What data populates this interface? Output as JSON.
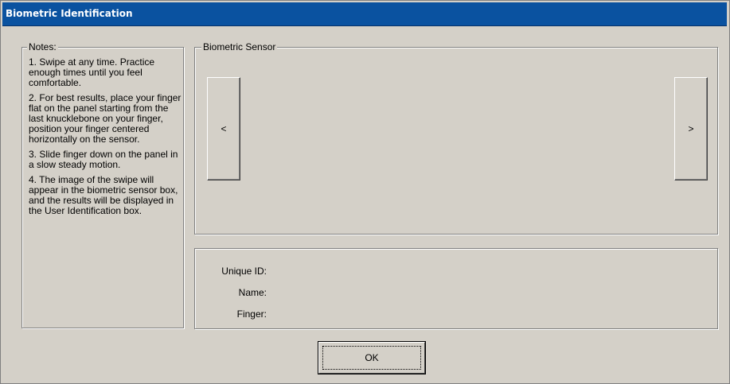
{
  "window": {
    "title": "Biometric Identification"
  },
  "notes": {
    "legend": "Notes:",
    "items": [
      "1. Swipe at any time. Practice enough times until you feel comfortable.",
      "2. For best results, place your finger flat on the panel starting from the last knucklebone on your finger, position your finger centered horizontally on the sensor.",
      "3. Slide finger down on the panel in a slow steady motion.",
      "4. The image of the swipe will appear in the biometric sensor box, and the results will be displayed in the User Identification box."
    ]
  },
  "sensor": {
    "legend": "Biometric Sensor",
    "prev_label": "<",
    "next_label": ">"
  },
  "identification": {
    "unique_id_label": "Unique ID:",
    "name_label": "Name:",
    "finger_label": "Finger:"
  },
  "footer": {
    "ok_label": "OK"
  }
}
